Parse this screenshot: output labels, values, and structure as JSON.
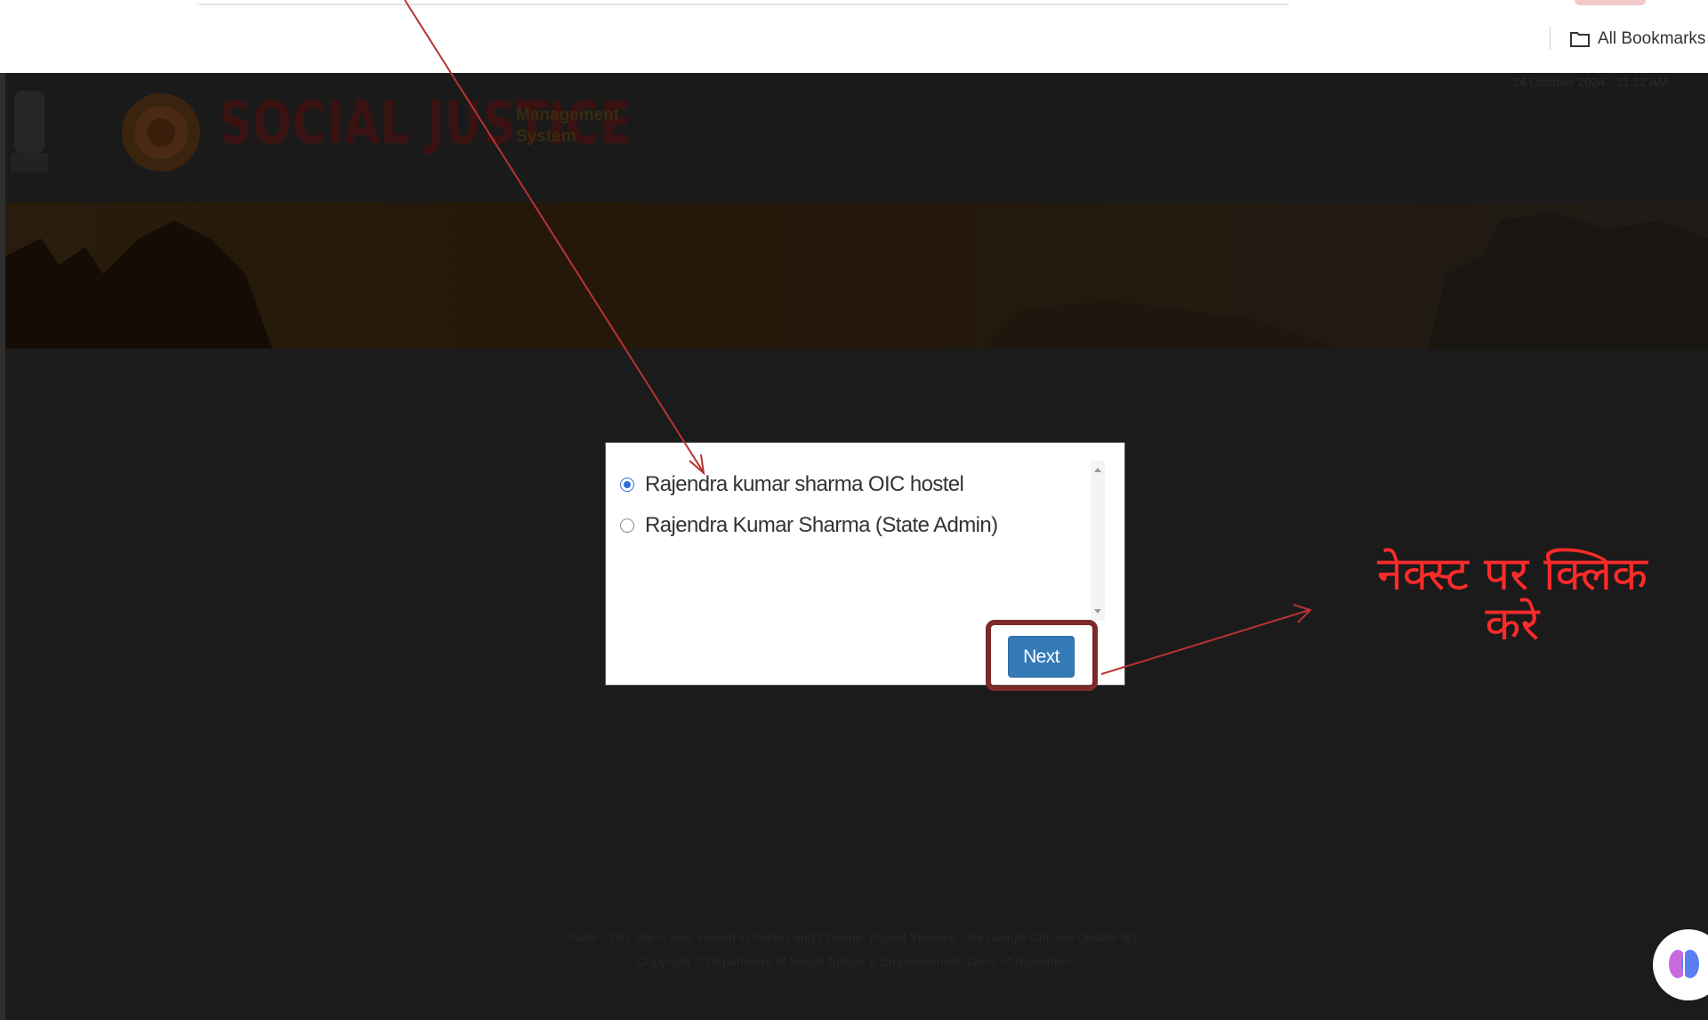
{
  "browser": {
    "bookmarks_label": "All Bookmarks"
  },
  "header": {
    "logo_text": "SOCIAL JUSTICE",
    "logo_sub_line1": "Management",
    "logo_sub_line2": "System",
    "date_text": "24 October 2024 - 11:22 AM"
  },
  "modal": {
    "options": [
      {
        "label": "Rajendra kumar sharma OIC hostel",
        "checked": true
      },
      {
        "label": "Rajendra Kumar Sharma (State Admin)",
        "checked": false
      }
    ],
    "next_label": "Next"
  },
  "annotation": {
    "line1": "नेक्स्ट पर क्लिक",
    "line2": "करे"
  },
  "footer": {
    "line1": "Note : This site is best viewed in Firefox and Chrome. Report Viewers: Use Google Chrome (and/or IE)",
    "line2": "Copyright © Department of Social Justice & Empowerment, Govt. of Rajasthan"
  },
  "colors": {
    "overlay": "#1b1b1b",
    "annotation": "#ff2a2a",
    "next_button": "#337ab7",
    "highlight_box": "#7e2a2a"
  }
}
